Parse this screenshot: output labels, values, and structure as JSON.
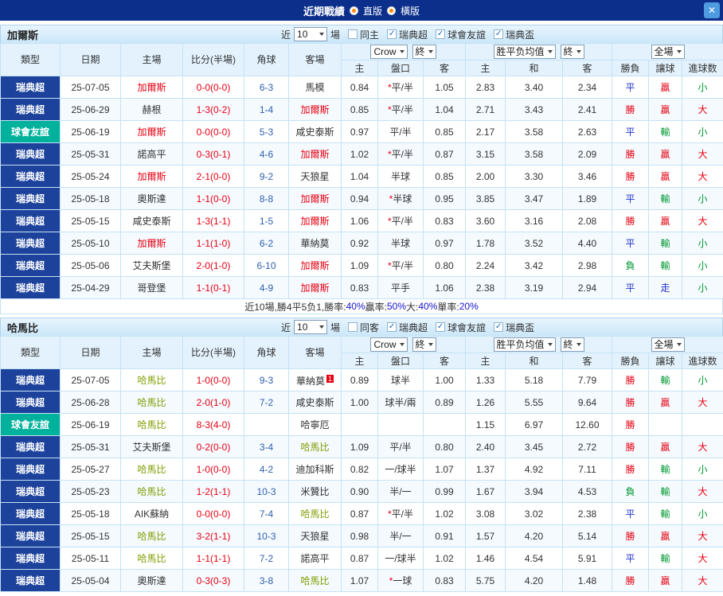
{
  "titlebar": {
    "title": "近期戰績",
    "radios": [
      {
        "label": "直版"
      },
      {
        "label": "橫版"
      }
    ]
  },
  "icons": {
    "check": "✓",
    "close": "✕"
  },
  "colors": {
    "title_bg": "#0b2f8b",
    "league_bg": {
      "瑞典超": "#1c429c",
      "球會友誼": "#00b19c"
    },
    "result": {
      "勝": "#e60012",
      "負": "#009933",
      "平": "#2233cc",
      "贏": "#e60012",
      "輸": "#009933",
      "走": "#2233cc",
      "大": "#e60012",
      "小": "#009933"
    },
    "score": "#e60012",
    "corner": "#2f5fae",
    "plain_team": "#333333",
    "percent": "#1414cc"
  },
  "table_headers": {
    "type": "類型",
    "date": "日期",
    "home": "主場",
    "score": "比分(半場)",
    "corner": "角球",
    "away": "客場",
    "odds_home": "主",
    "odds_line": "盤口",
    "odds_away": "客",
    "euro_home": "主",
    "euro_draw": "和",
    "euro_away": "客",
    "res_wdl": "勝負",
    "res_handicap": "讓球",
    "res_goals": "進球数"
  },
  "controls_labels": {
    "near": "近",
    "count": "10",
    "games": "場",
    "odds_provider": "Crow",
    "final": "終",
    "euro_avg": "胜平负均值",
    "scope": "全場"
  },
  "sections": [
    {
      "team": "加爾斯",
      "team_color": "#e60012",
      "filters": [
        {
          "label": "同主",
          "checked": false
        },
        {
          "label": "瑞典超",
          "checked": true
        },
        {
          "label": "球會友誼",
          "checked": true
        },
        {
          "label": "瑞典盃",
          "checked": true
        }
      ],
      "rows": [
        {
          "type": "瑞典超",
          "date": "25-07-05",
          "home": "加爾斯",
          "home_focal": true,
          "score": "0-0(0-0)",
          "corner": "6-3",
          "away": "馬模",
          "ah": [
            "0.84",
            "*平/半",
            "1.05"
          ],
          "euro": [
            "2.83",
            "3.40",
            "2.34"
          ],
          "res": [
            "平",
            "贏",
            "小"
          ]
        },
        {
          "type": "瑞典超",
          "date": "25-06-29",
          "home": "赫根",
          "score": "1-3(0-2)",
          "corner": "1-4",
          "away": "加爾斯",
          "away_focal": true,
          "ah": [
            "0.85",
            "*平/半",
            "1.04"
          ],
          "euro": [
            "2.71",
            "3.43",
            "2.41"
          ],
          "res": [
            "勝",
            "贏",
            "大"
          ]
        },
        {
          "type": "球會友誼",
          "date": "25-06-19",
          "home": "加爾斯",
          "home_focal": true,
          "score": "0-0(0-0)",
          "corner": "5-3",
          "away": "咸史泰斯",
          "ah": [
            "0.97",
            "平/半",
            "0.85"
          ],
          "euro": [
            "2.17",
            "3.58",
            "2.63"
          ],
          "res": [
            "平",
            "輸",
            "小"
          ]
        },
        {
          "type": "瑞典超",
          "date": "25-05-31",
          "home": "諾高平",
          "score": "0-3(0-1)",
          "corner": "4-6",
          "away": "加爾斯",
          "away_focal": true,
          "ah": [
            "1.02",
            "*平/半",
            "0.87"
          ],
          "euro": [
            "3.15",
            "3.58",
            "2.09"
          ],
          "res": [
            "勝",
            "贏",
            "大"
          ]
        },
        {
          "type": "瑞典超",
          "date": "25-05-24",
          "home": "加爾斯",
          "home_focal": true,
          "score": "2-1(0-0)",
          "corner": "9-2",
          "away": "天狼星",
          "ah": [
            "1.04",
            "半球",
            "0.85"
          ],
          "euro": [
            "2.00",
            "3.30",
            "3.46"
          ],
          "res": [
            "勝",
            "贏",
            "大"
          ]
        },
        {
          "type": "瑞典超",
          "date": "25-05-18",
          "home": "奧斯達",
          "score": "1-1(0-0)",
          "corner": "8-8",
          "away": "加爾斯",
          "away_focal": true,
          "ah": [
            "0.94",
            "*半球",
            "0.95"
          ],
          "euro": [
            "3.85",
            "3.47",
            "1.89"
          ],
          "res": [
            "平",
            "輸",
            "小"
          ]
        },
        {
          "type": "瑞典超",
          "date": "25-05-15",
          "home": "咸史泰斯",
          "score": "1-3(1-1)",
          "corner": "1-5",
          "away": "加爾斯",
          "away_focal": true,
          "ah": [
            "1.06",
            "*平/半",
            "0.83"
          ],
          "euro": [
            "3.60",
            "3.16",
            "2.08"
          ],
          "res": [
            "勝",
            "贏",
            "大"
          ]
        },
        {
          "type": "瑞典超",
          "date": "25-05-10",
          "home": "加爾斯",
          "home_focal": true,
          "score": "1-1(1-0)",
          "corner": "6-2",
          "away": "華納莫",
          "ah": [
            "0.92",
            "半球",
            "0.97"
          ],
          "euro": [
            "1.78",
            "3.52",
            "4.40"
          ],
          "res": [
            "平",
            "輸",
            "小"
          ]
        },
        {
          "type": "瑞典超",
          "date": "25-05-06",
          "home": "艾夫斯堡",
          "score": "2-0(1-0)",
          "corner": "6-10",
          "away": "加爾斯",
          "away_focal": true,
          "ah": [
            "1.09",
            "*平/半",
            "0.80"
          ],
          "euro": [
            "2.24",
            "3.42",
            "2.98"
          ],
          "res": [
            "負",
            "輸",
            "小"
          ]
        },
        {
          "type": "瑞典超",
          "date": "25-04-29",
          "home": "哥登堡",
          "score": "1-1(0-1)",
          "corner": "4-9",
          "away": "加爾斯",
          "away_focal": true,
          "ah": [
            "0.83",
            "平手",
            "1.06"
          ],
          "euro": [
            "2.38",
            "3.19",
            "2.94"
          ],
          "res": [
            "平",
            "走",
            "小"
          ]
        }
      ],
      "summary": [
        {
          "text": "近10場,勝4平5负1, ",
          "color": "#333333"
        },
        {
          "text": "勝率:",
          "color": "#333333"
        },
        {
          "text": "40%",
          "color": "#1414cc"
        },
        {
          "text": " 贏率:",
          "color": "#333333"
        },
        {
          "text": "50%",
          "color": "#1414cc"
        },
        {
          "text": " 大:",
          "color": "#333333"
        },
        {
          "text": "40%",
          "color": "#1414cc"
        },
        {
          "text": " 單率:",
          "color": "#333333"
        },
        {
          "text": "20%",
          "color": "#1414cc"
        }
      ]
    },
    {
      "team": "哈馬比",
      "team_color": "#7f9e00",
      "filters": [
        {
          "label": "同客",
          "checked": false
        },
        {
          "label": "瑞典超",
          "checked": true
        },
        {
          "label": "球會友誼",
          "checked": true
        },
        {
          "label": "瑞典盃",
          "checked": true
        }
      ],
      "rows": [
        {
          "type": "瑞典超",
          "date": "25-07-05",
          "home": "哈馬比",
          "home_focal": true,
          "score": "1-0(0-0)",
          "corner": "9-3",
          "away": "華納莫",
          "away_card": "1",
          "ah": [
            "0.89",
            "球半",
            "1.00"
          ],
          "euro": [
            "1.33",
            "5.18",
            "7.79"
          ],
          "res": [
            "勝",
            "輸",
            "小"
          ]
        },
        {
          "type": "瑞典超",
          "date": "25-06-28",
          "home": "哈馬比",
          "home_focal": true,
          "score": "2-0(1-0)",
          "corner": "7-2",
          "away": "咸史泰斯",
          "ah": [
            "1.00",
            "球半/兩",
            "0.89"
          ],
          "euro": [
            "1.26",
            "5.55",
            "9.64"
          ],
          "res": [
            "勝",
            "贏",
            "大"
          ]
        },
        {
          "type": "球會友誼",
          "date": "25-06-19",
          "home": "哈馬比",
          "home_focal": true,
          "score": "8-3(4-0)",
          "corner": "",
          "away": "哈寧厄",
          "ah": [
            "",
            "",
            ""
          ],
          "euro": [
            "1.15",
            "6.97",
            "12.60"
          ],
          "res": [
            "勝",
            "",
            ""
          ]
        },
        {
          "type": "瑞典超",
          "date": "25-05-31",
          "home": "艾夫斯堡",
          "score": "0-2(0-0)",
          "corner": "3-4",
          "away": "哈馬比",
          "away_focal": true,
          "ah": [
            "1.09",
            "平/半",
            "0.80"
          ],
          "euro": [
            "2.40",
            "3.45",
            "2.72"
          ],
          "res": [
            "勝",
            "贏",
            "大"
          ]
        },
        {
          "type": "瑞典超",
          "date": "25-05-27",
          "home": "哈馬比",
          "home_focal": true,
          "score": "1-0(0-0)",
          "corner": "4-2",
          "away": "迪加科斯",
          "ah": [
            "0.82",
            "一/球半",
            "1.07"
          ],
          "euro": [
            "1.37",
            "4.92",
            "7.11"
          ],
          "res": [
            "勝",
            "輸",
            "小"
          ]
        },
        {
          "type": "瑞典超",
          "date": "25-05-23",
          "home": "哈馬比",
          "home_focal": true,
          "score": "1-2(1-1)",
          "corner": "10-3",
          "away": "米贊比",
          "ah": [
            "0.90",
            "半/一",
            "0.99"
          ],
          "euro": [
            "1.67",
            "3.94",
            "4.53"
          ],
          "res": [
            "負",
            "輸",
            "大"
          ]
        },
        {
          "type": "瑞典超",
          "date": "25-05-18",
          "home": "AIK蘇納",
          "score": "0-0(0-0)",
          "corner": "7-4",
          "away": "哈馬比",
          "away_focal": true,
          "ah": [
            "0.87",
            "*平/半",
            "1.02"
          ],
          "euro": [
            "3.08",
            "3.02",
            "2.38"
          ],
          "res": [
            "平",
            "輸",
            "小"
          ]
        },
        {
          "type": "瑞典超",
          "date": "25-05-15",
          "home": "哈馬比",
          "home_focal": true,
          "score": "3-2(1-1)",
          "corner": "10-3",
          "away": "天狼星",
          "ah": [
            "0.98",
            "半/一",
            "0.91"
          ],
          "euro": [
            "1.57",
            "4.20",
            "5.14"
          ],
          "res": [
            "勝",
            "贏",
            "大"
          ]
        },
        {
          "type": "瑞典超",
          "date": "25-05-11",
          "home": "哈馬比",
          "home_focal": true,
          "score": "1-1(1-1)",
          "corner": "7-2",
          "away": "諾高平",
          "ah": [
            "0.87",
            "一/球半",
            "1.02"
          ],
          "euro": [
            "1.46",
            "4.54",
            "5.91"
          ],
          "res": [
            "平",
            "輸",
            "大"
          ]
        },
        {
          "type": "瑞典超",
          "date": "25-05-04",
          "home": "奧斯達",
          "score": "0-3(0-3)",
          "corner": "3-8",
          "away": "哈馬比",
          "away_focal": true,
          "ah": [
            "1.07",
            "*一球",
            "0.83"
          ],
          "euro": [
            "5.75",
            "4.20",
            "1.48"
          ],
          "res": [
            "勝",
            "贏",
            "大"
          ]
        }
      ],
      "summary": []
    }
  ]
}
